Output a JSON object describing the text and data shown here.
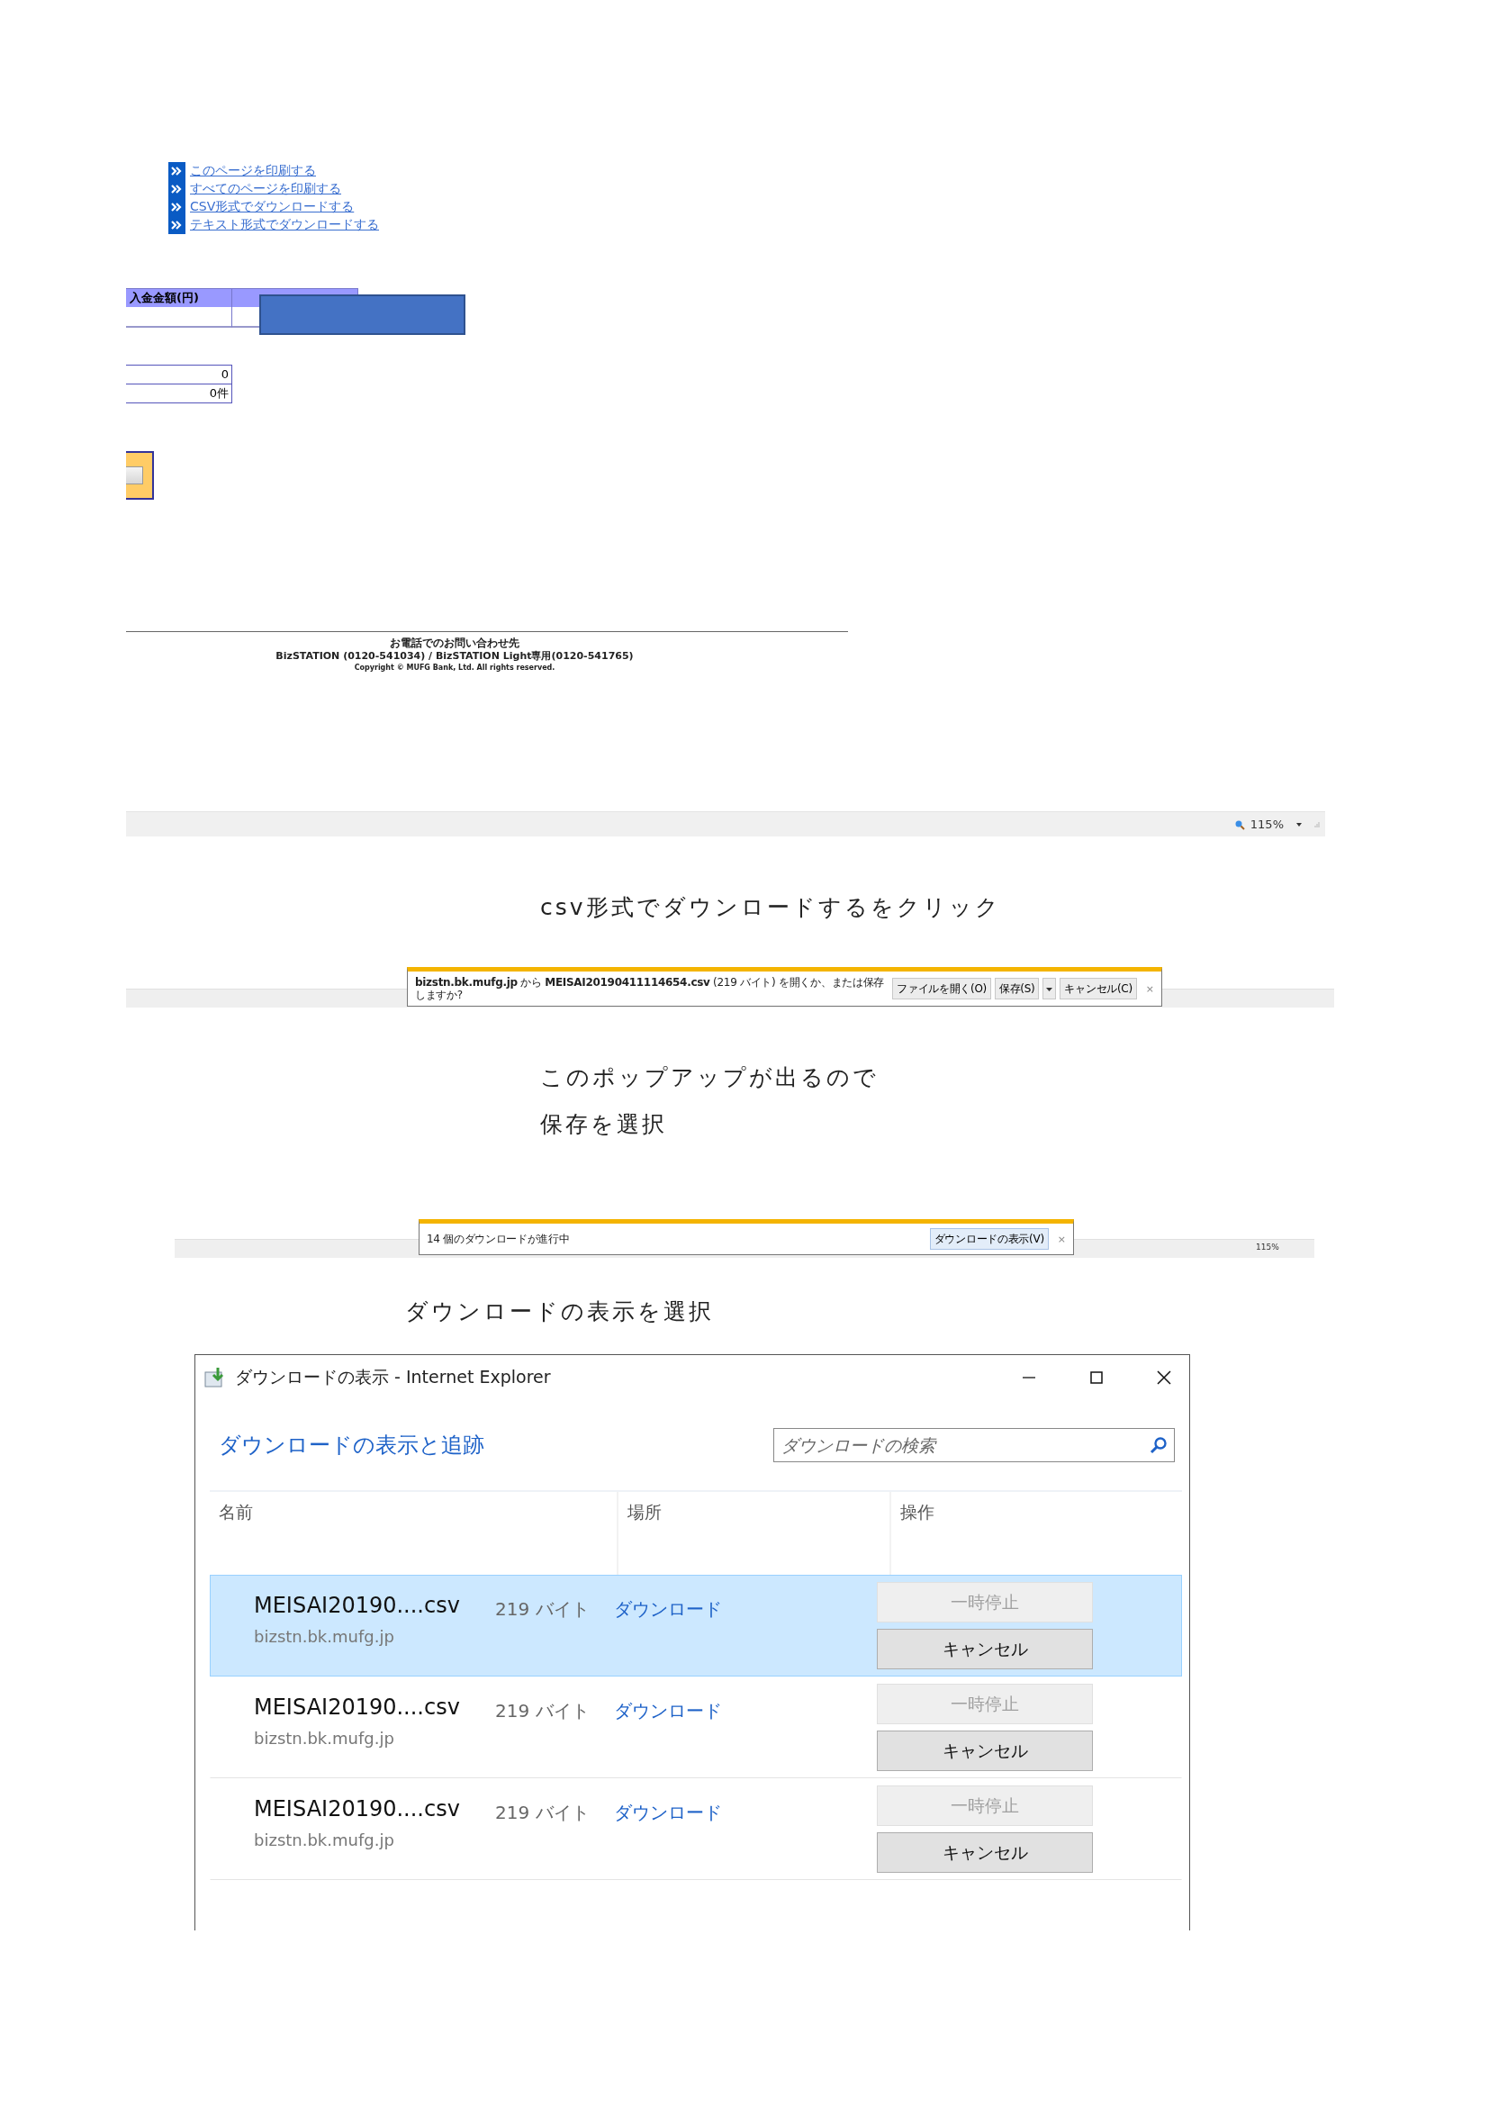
{
  "links": [
    "このページを印刷する",
    "すべてのページを印刷する",
    "CSV形式でダウンロードする",
    "テキスト形式でダウンロードする"
  ],
  "table": {
    "columns": [
      "入金金額(円)"
    ]
  },
  "summary": [
    "0",
    "0件"
  ],
  "footer": {
    "contact_label": "お電話でのお問い合わせ先",
    "contact": "BizSTATION (0120-541034) / BizSTATION Light専用(0120-541765)",
    "copyright": "Copyright © MUFG Bank, Ltd. All rights reserved."
  },
  "status_bar": {
    "zoom": "115%"
  },
  "caption_1": "csv形式でダウンロードするをクリック",
  "download_prompt": {
    "message": "**bizstn.bk.mufg.jp** から **MEISAI20190411114654.csv** (219 バイト) を開くか、または保存しますか?",
    "buttons": [
      "ファイルを開く(O)",
      "保存(S)",
      "キャンセル(C)"
    ],
    "close": "×"
  },
  "caption_2": [
    "このポップアップが出るので",
    "保存を選択"
  ],
  "download_bar": {
    "message": "14 個のダウンロードが進行中",
    "button": "ダウンロードの表示(V)",
    "close": "×",
    "zoom": "115%"
  },
  "caption_3": "ダウンロードの表示を選択",
  "window": {
    "title": "ダウンロードの表示 - Internet Explorer",
    "heading": "ダウンロードの表示と追跡",
    "search": {
      "placeholder": "ダウンロードの検索"
    },
    "columns": [
      "名前",
      "場所",
      "操作"
    ],
    "downloads": [
      {
        "name": "MEISAI20190....csv",
        "size": "219 バイト",
        "host": "bizstn.bk.mufg.jp",
        "location": "ダウンロード",
        "pause": {
          "label": "一時停止",
          "disabled": true
        },
        "cancel": "キャンセル",
        "selected": true
      },
      {
        "name": "MEISAI20190....csv",
        "size": "219 バイト",
        "host": "bizstn.bk.mufg.jp",
        "location": "ダウンロード",
        "pause": {
          "label": "一時停止",
          "disabled": true
        },
        "cancel": "キャンセル",
        "selected": false
      },
      {
        "name": "MEISAI20190....csv",
        "size": "219 バイト",
        "host": "bizstn.bk.mufg.jp",
        "location": "ダウンロード",
        "pause": {
          "label": "一時停止",
          "disabled": true
        },
        "cancel": "キャンセル",
        "selected": false
      }
    ]
  }
}
